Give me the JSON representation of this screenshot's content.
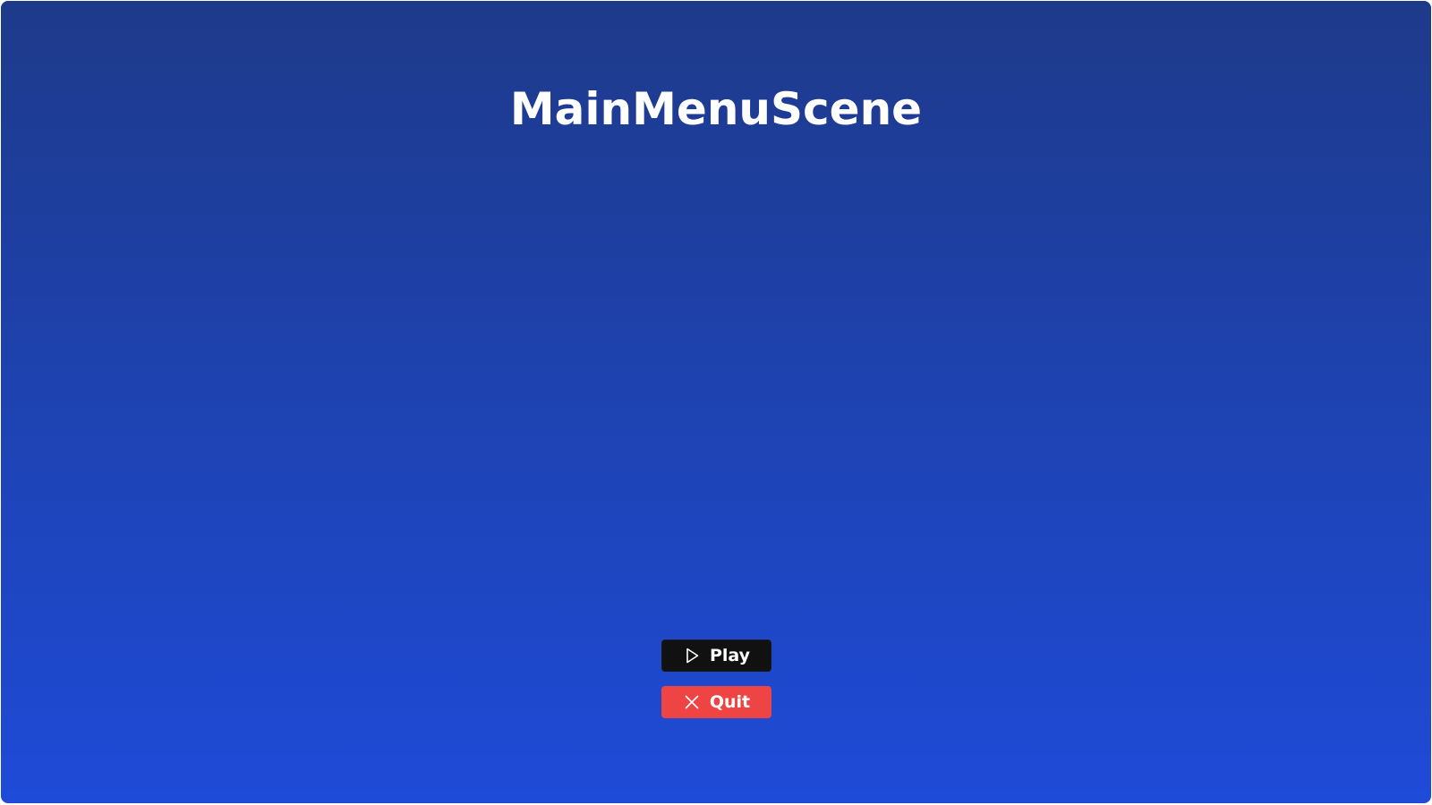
{
  "scene": {
    "title": "MainMenuScene",
    "background_top": "#1e3a8a",
    "background_bottom": "#1e4bd8"
  },
  "menu": {
    "play": {
      "label": "Play",
      "icon": "play-icon",
      "color": "#111111"
    },
    "quit": {
      "label": "Quit",
      "icon": "close-icon",
      "color": "#ef4444"
    }
  }
}
